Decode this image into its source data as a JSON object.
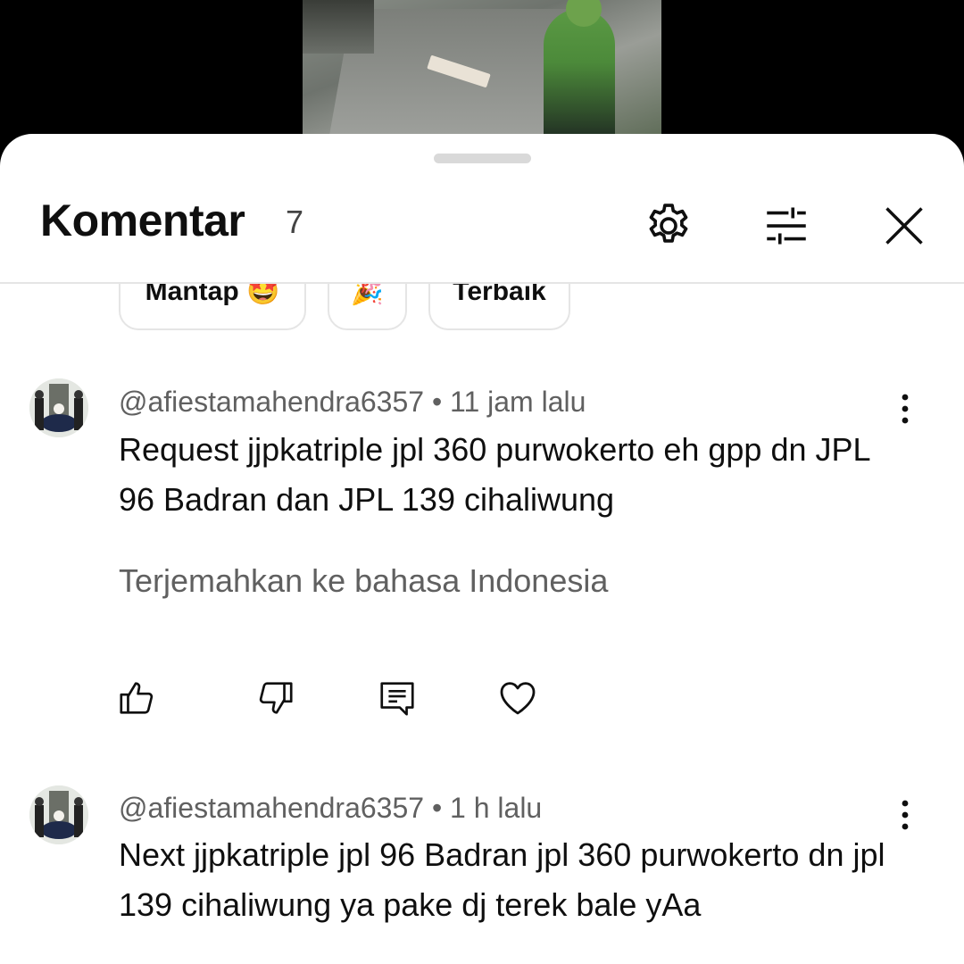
{
  "header": {
    "title": "Komentar",
    "count": "7"
  },
  "chips": [
    {
      "label": "Mantap 🤩"
    },
    {
      "label": "🎉"
    },
    {
      "label": "Terbaik"
    }
  ],
  "comments": [
    {
      "author": "@afiestamahendra6357",
      "time": "11 jam lalu",
      "text": "Request jjpkatriple jpl 360 purwokerto eh gpp dn JPL 96 Badran dan JPL 139 cihaliwung",
      "translate_label": "Terjemahkan ke bahasa Indonesia"
    },
    {
      "author": "@afiestamahendra6357",
      "time": "1 h lalu",
      "text": "Next jjpkatriple jpl 96 Badran jpl 360 purwokerto dn jpl 139 cihaliwung ya pake dj terek bale yAa"
    }
  ],
  "meta_separator": " • ",
  "icons": [
    "settings-icon",
    "filter-icon",
    "close-icon",
    "more-vert-icon",
    "like-icon",
    "dislike-icon",
    "reply-icon",
    "heart-icon"
  ]
}
